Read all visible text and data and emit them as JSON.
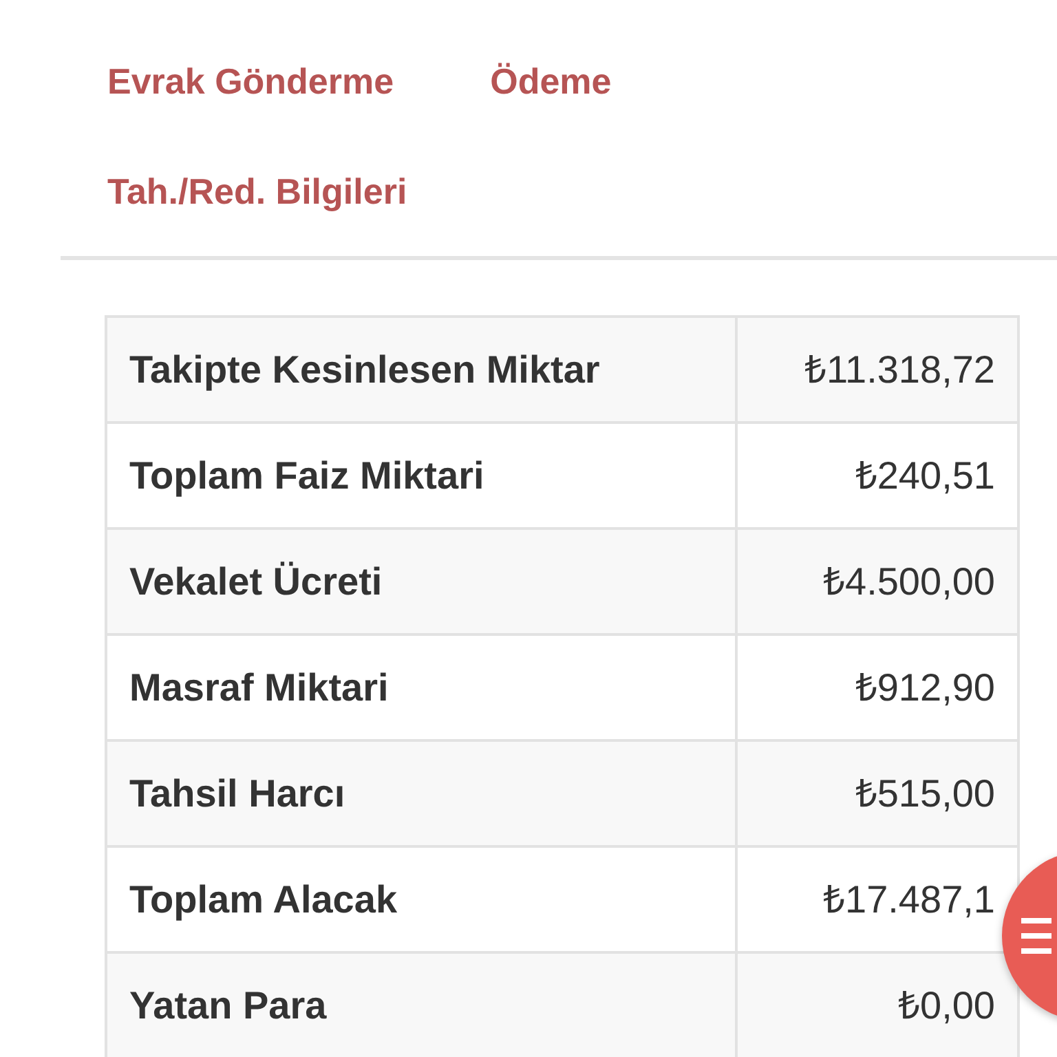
{
  "tabs": [
    {
      "label": "Evrak Gönderme"
    },
    {
      "label": "Ödeme"
    },
    {
      "label": "Tah./Red. Bilgileri"
    }
  ],
  "table": {
    "rows": [
      {
        "label": "Takipte Kesinlesen Miktar",
        "value": "₺11.318,72"
      },
      {
        "label": "Toplam Faiz Miktari",
        "value": "₺240,51"
      },
      {
        "label": "Vekalet Ücreti",
        "value": "₺4.500,00"
      },
      {
        "label": "Masraf Miktari",
        "value": "₺912,90"
      },
      {
        "label": "Tahsil Harcı",
        "value": "₺515,00"
      },
      {
        "label": "Toplam Alacak",
        "value": "₺17.487,1"
      },
      {
        "label": "Yatan Para",
        "value": "₺0,00"
      }
    ]
  }
}
